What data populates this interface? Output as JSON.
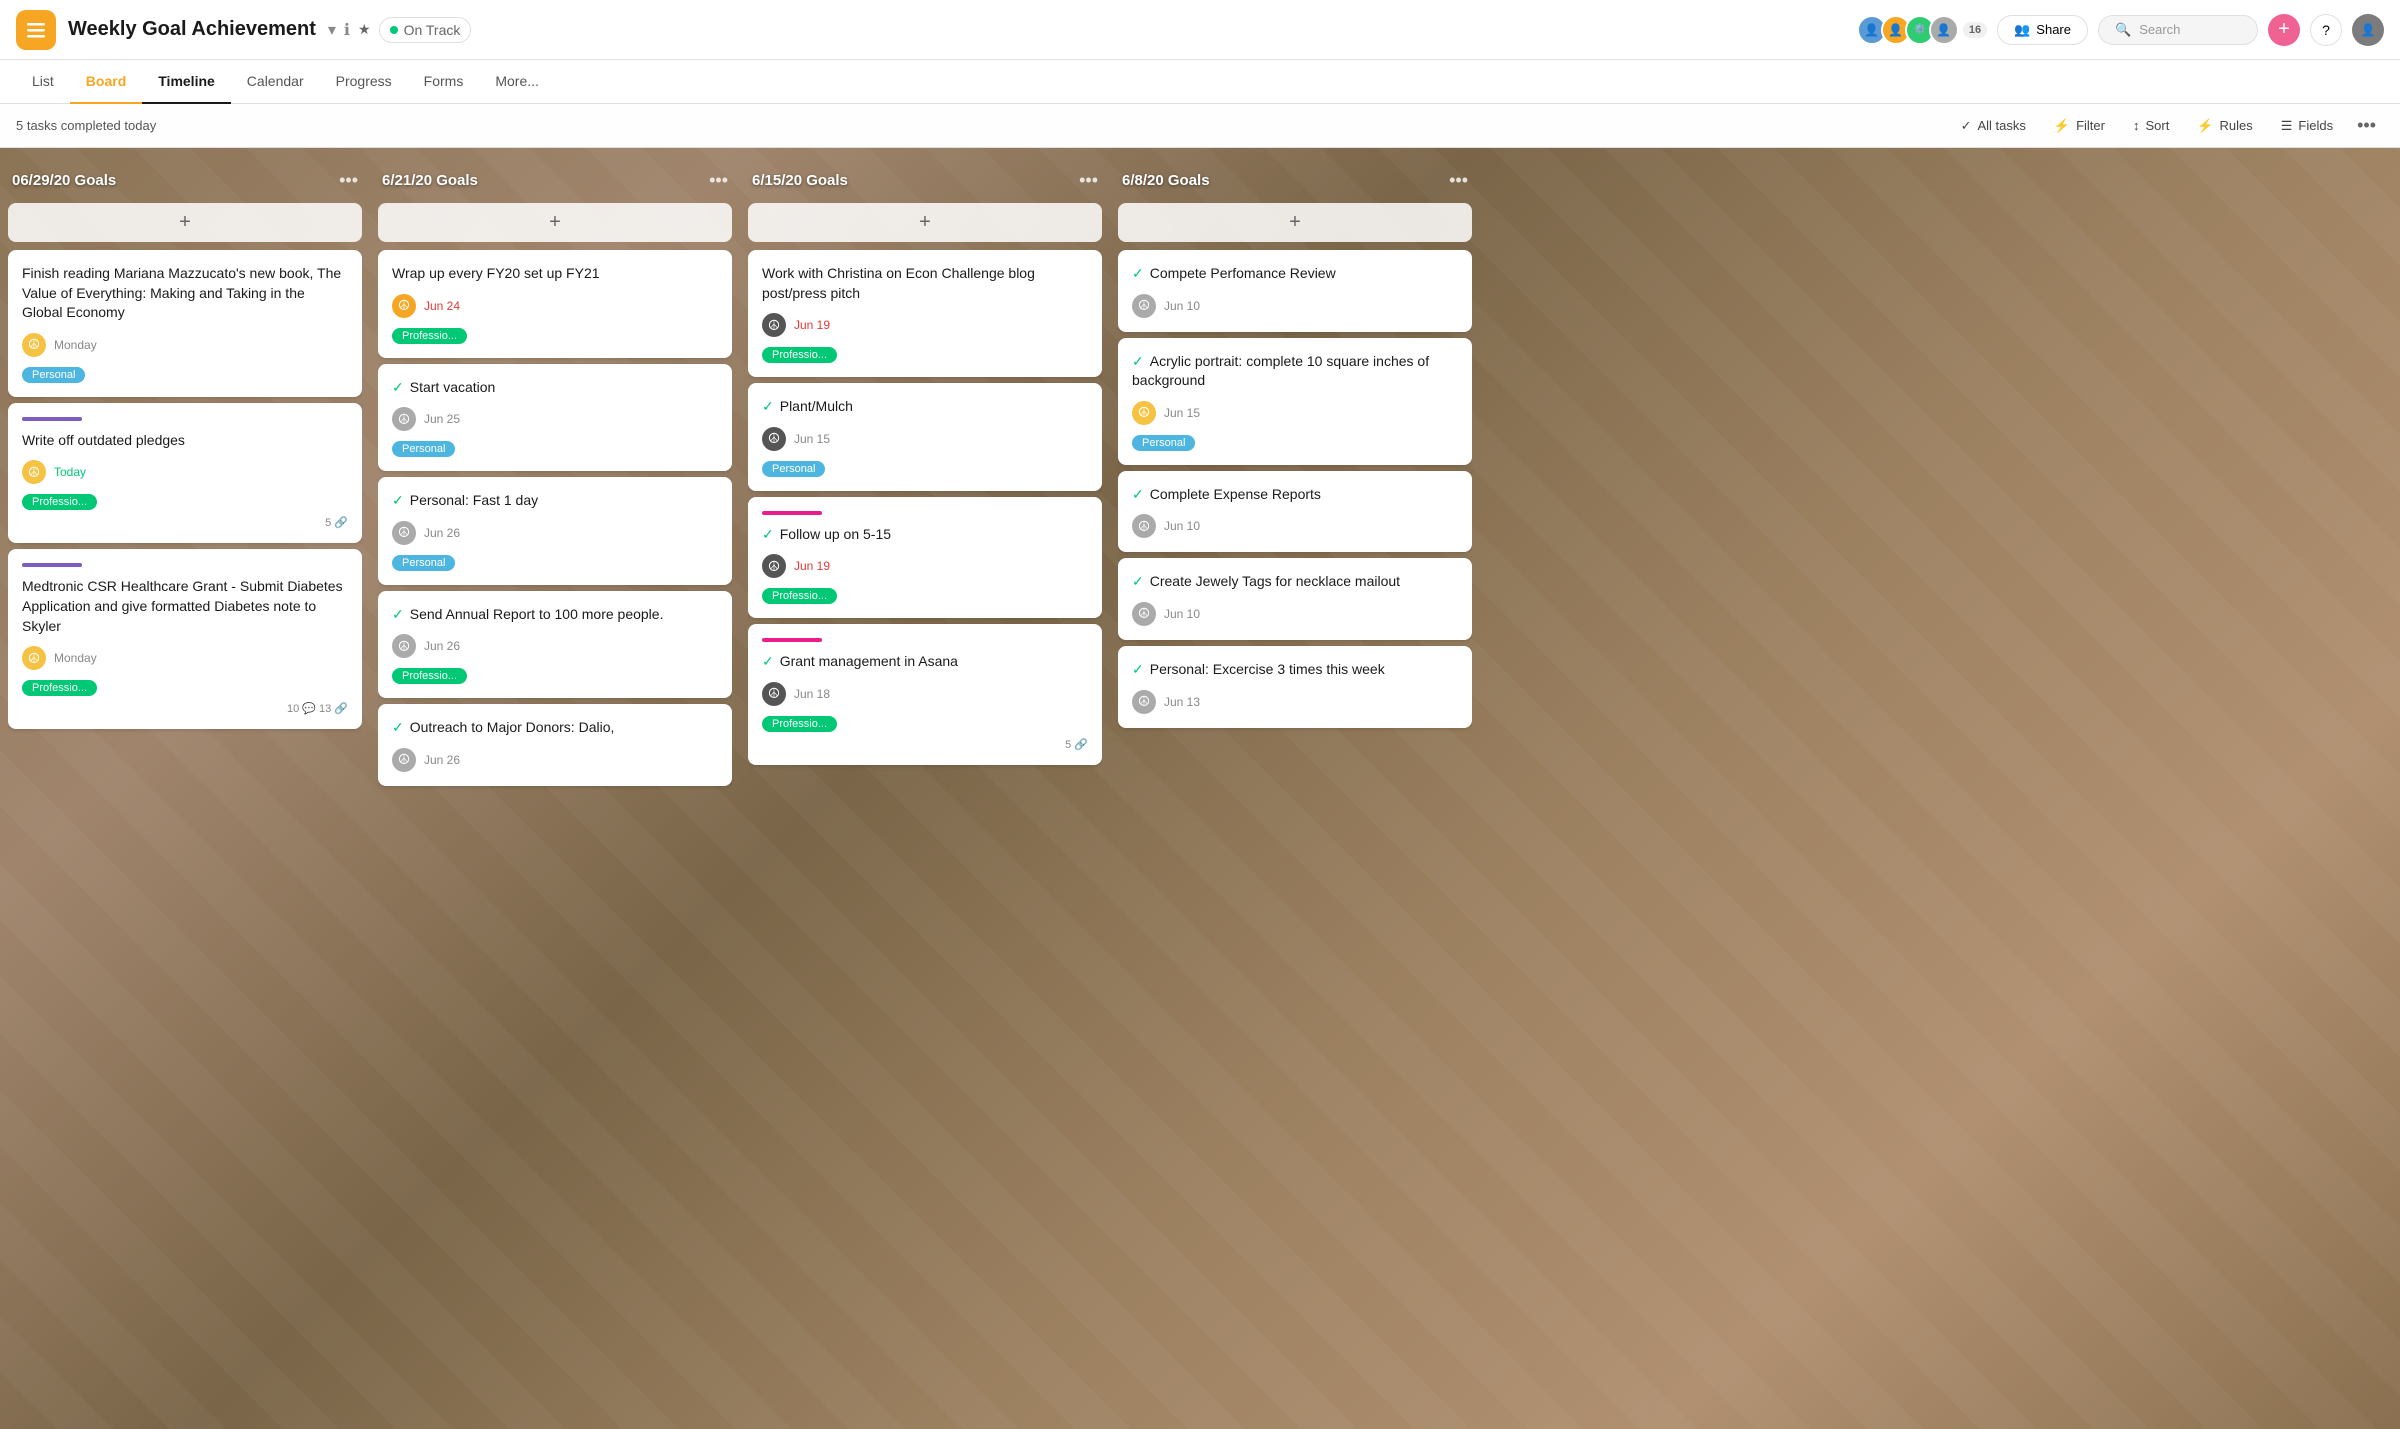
{
  "app": {
    "icon_label": "menu-icon",
    "title": "Weekly Goal Achievement",
    "status": "On Track",
    "status_color": "#00c875"
  },
  "nav": {
    "items": [
      {
        "label": "List",
        "active": false
      },
      {
        "label": "Board",
        "active": true,
        "style": "orange"
      },
      {
        "label": "Timeline",
        "active": true,
        "style": "underline"
      },
      {
        "label": "Calendar",
        "active": false
      },
      {
        "label": "Progress",
        "active": false
      },
      {
        "label": "Forms",
        "active": false
      },
      {
        "label": "More...",
        "active": false
      }
    ],
    "avatar_count": "16",
    "share_label": "Share",
    "search_placeholder": "Search"
  },
  "toolbar": {
    "tasks_completed": "5 tasks completed today",
    "all_tasks": "All tasks",
    "filter": "Filter",
    "sort": "Sort",
    "rules": "Rules",
    "fields": "Fields"
  },
  "columns": [
    {
      "id": "col1",
      "title": "06/29/20 Goals",
      "cards": [
        {
          "id": "c1",
          "title": "Finish reading Mariana Mazzucato's new book, The Value of Everything: Making and Taking in the Global Economy",
          "assignee_color": "av-yellow",
          "date": "Monday",
          "date_color": "normal",
          "tag": "Personal",
          "tag_class": "tag-personal",
          "bar": "bar-none",
          "stats": "",
          "completed": false
        },
        {
          "id": "c2",
          "title": "Write off outdated pledges",
          "assignee_color": "av-yellow",
          "date": "Today",
          "date_color": "green",
          "tag": "Professio...",
          "tag_class": "tag-professio",
          "bar": "bar-purple",
          "stats": "5",
          "completed": false
        },
        {
          "id": "c3",
          "title": "Medtronic CSR Healthcare Grant - Submit Diabetes Application and give formatted Diabetes note to Skyler",
          "assignee_color": "av-yellow",
          "date": "Monday",
          "date_color": "normal",
          "tag": "Professio...",
          "tag_class": "tag-professio",
          "bar": "bar-purple",
          "stats": "10 13",
          "completed": false
        }
      ]
    },
    {
      "id": "col2",
      "title": "6/21/20 Goals",
      "cards": [
        {
          "id": "c4",
          "title": "Wrap up every FY20 set up FY21",
          "assignee_color": "av-orange",
          "date": "Jun 24",
          "date_color": "red",
          "tag": "Professio...",
          "tag_class": "tag-professio",
          "bar": "bar-none",
          "stats": "",
          "completed": false
        },
        {
          "id": "c5",
          "title": "Start vacation",
          "assignee_color": "av-gray",
          "date": "Jun 25",
          "date_color": "normal",
          "tag": "Personal",
          "tag_class": "tag-personal",
          "bar": "bar-none",
          "stats": "",
          "completed": true
        },
        {
          "id": "c6",
          "title": "Personal: Fast 1 day",
          "assignee_color": "av-gray",
          "date": "Jun 26",
          "date_color": "normal",
          "tag": "Personal",
          "tag_class": "tag-personal",
          "bar": "bar-none",
          "stats": "",
          "completed": true
        },
        {
          "id": "c7",
          "title": "Send Annual Report to 100 more people.",
          "assignee_color": "av-gray",
          "date": "Jun 26",
          "date_color": "normal",
          "tag": "Professio...",
          "tag_class": "tag-professio",
          "bar": "bar-none",
          "stats": "",
          "completed": true
        },
        {
          "id": "c8",
          "title": "Outreach to Major Donors: Dalio,",
          "assignee_color": "av-gray",
          "date": "Jun 26",
          "date_color": "normal",
          "tag": "",
          "tag_class": "",
          "bar": "bar-none",
          "stats": "",
          "completed": true
        }
      ]
    },
    {
      "id": "col3",
      "title": "6/15/20 Goals",
      "cards": [
        {
          "id": "c9",
          "title": "Work with Christina on Econ Challenge blog post/press pitch",
          "assignee_color": "av-dark",
          "date": "Jun 19",
          "date_color": "red",
          "tag": "Professio...",
          "tag_class": "tag-professio",
          "bar": "bar-none",
          "stats": "",
          "completed": false
        },
        {
          "id": "c10",
          "title": "Plant/Mulch",
          "assignee_color": "av-dark",
          "date": "Jun 15",
          "date_color": "normal",
          "tag": "Personal",
          "tag_class": "tag-personal",
          "bar": "bar-none",
          "stats": "",
          "completed": true
        },
        {
          "id": "c11",
          "title": "Follow up on 5-15",
          "assignee_color": "av-dark",
          "date": "Jun 19",
          "date_color": "red",
          "tag": "Professio...",
          "tag_class": "tag-professio",
          "bar": "bar-pink",
          "stats": "",
          "completed": true
        },
        {
          "id": "c12",
          "title": "Grant management in Asana",
          "assignee_color": "av-dark",
          "date": "Jun 18",
          "date_color": "normal",
          "tag": "Professio...",
          "tag_class": "tag-professio",
          "bar": "bar-pink",
          "stats": "5",
          "completed": true
        }
      ]
    },
    {
      "id": "col4",
      "title": "6/8/20 Goals",
      "cards": [
        {
          "id": "c13",
          "title": "Compete Perfomance Review",
          "assignee_color": "av-gray",
          "date": "Jun 10",
          "date_color": "normal",
          "tag": "",
          "tag_class": "",
          "bar": "bar-none",
          "stats": "",
          "completed": true
        },
        {
          "id": "c14",
          "title": "Acrylic portrait: complete 10 square inches of background",
          "assignee_color": "av-yellow",
          "date": "Jun 15",
          "date_color": "normal",
          "tag": "Personal",
          "tag_class": "tag-personal",
          "bar": "bar-none",
          "stats": "",
          "completed": true
        },
        {
          "id": "c15",
          "title": "Complete Expense Reports",
          "assignee_color": "av-gray",
          "date": "Jun 10",
          "date_color": "normal",
          "tag": "",
          "tag_class": "",
          "bar": "bar-none",
          "stats": "",
          "completed": true
        },
        {
          "id": "c16",
          "title": "Create Jewely Tags for necklace mailout",
          "assignee_color": "av-gray",
          "date": "Jun 10",
          "date_color": "normal",
          "tag": "",
          "tag_class": "",
          "bar": "bar-none",
          "stats": "",
          "completed": true
        },
        {
          "id": "c17",
          "title": "Personal: Excercise 3 times this week",
          "assignee_color": "av-gray",
          "date": "Jun 13",
          "date_color": "normal",
          "tag": "",
          "tag_class": "",
          "bar": "bar-none",
          "stats": "",
          "completed": true
        }
      ]
    }
  ]
}
